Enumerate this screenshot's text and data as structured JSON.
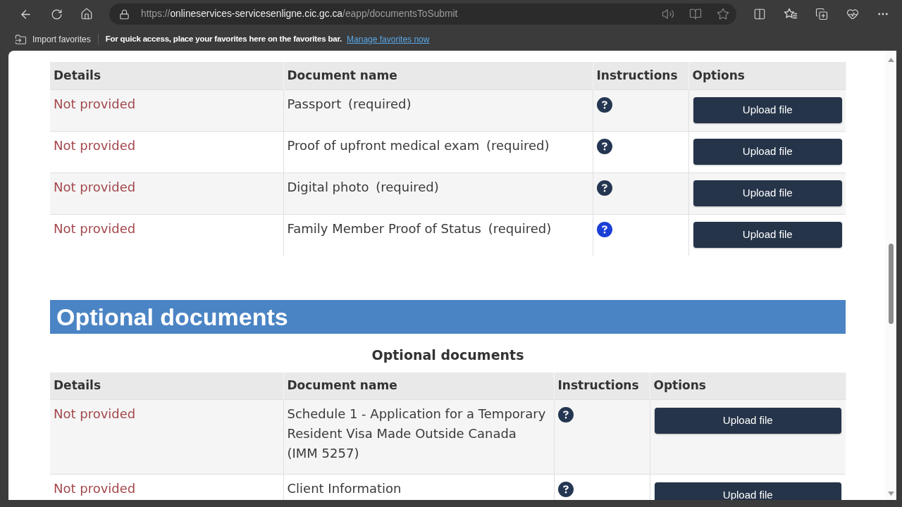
{
  "browser": {
    "url": {
      "scheme": "https://",
      "host": "onlineservices-servicesenligne.cic.gc.ca",
      "path": "/eapp/documentsToSubmit"
    }
  },
  "favorites_bar": {
    "import_label": "Import favorites",
    "message": "For quick access, place your favorites here on the favorites bar.",
    "link": "Manage favorites now"
  },
  "required_documents": {
    "columns": [
      "Details",
      "Document name",
      "Instructions",
      "Options"
    ],
    "rows": [
      {
        "details": "Not provided",
        "document": "Passport",
        "note": "(required)",
        "help_highlighted": false,
        "action": "Upload file"
      },
      {
        "details": "Not provided",
        "document": "Proof of upfront medical exam",
        "note": "(required)",
        "help_highlighted": false,
        "action": "Upload file"
      },
      {
        "details": "Not provided",
        "document": "Digital photo",
        "note": "(required)",
        "help_highlighted": false,
        "action": "Upload file"
      },
      {
        "details": "Not provided",
        "document": "Family Member Proof of Status",
        "note": "(required)",
        "help_highlighted": true,
        "action": "Upload file"
      }
    ]
  },
  "optional_documents": {
    "banner": "Optional documents",
    "caption": "Optional documents",
    "columns": [
      "Details",
      "Document name",
      "Instructions",
      "Options"
    ],
    "rows": [
      {
        "details": "Not provided",
        "document": "Schedule 1 - Application for a Temporary Resident Visa Made Outside Canada (IMM 5257)",
        "help_highlighted": false,
        "action": "Upload file"
      },
      {
        "details": "Not provided",
        "document": "Client Information",
        "help_highlighted": false,
        "action": "Upload file"
      }
    ]
  }
}
